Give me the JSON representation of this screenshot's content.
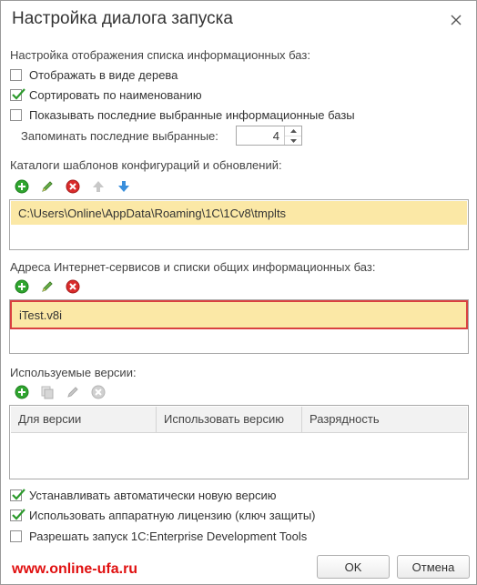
{
  "dialog": {
    "title": "Настройка диалога запуска"
  },
  "display_section": {
    "heading": "Настройка отображения списка информационных баз:",
    "options": [
      {
        "label": "Отображать в виде дерева",
        "checked": false
      },
      {
        "label": "Сортировать по наименованию",
        "checked": true
      },
      {
        "label": "Показывать последние выбранные информационные базы",
        "checked": false
      }
    ],
    "remember_label": "Запоминать последние выбранные:",
    "remember_value": "4"
  },
  "templates_section": {
    "heading": "Каталоги шаблонов конфигураций и обновлений:",
    "toolbar": [
      "add-icon",
      "edit-icon",
      "delete-icon",
      "move-up-icon",
      "move-down-icon"
    ],
    "items": [
      "C:\\Users\\Online\\AppData\\Roaming\\1C\\1Cv8\\tmplts"
    ]
  },
  "services_section": {
    "heading": "Адреса Интернет-сервисов и списки общих информационных баз:",
    "toolbar": [
      "add-icon",
      "edit-icon",
      "delete-icon"
    ],
    "items": [
      "iTest.v8i"
    ]
  },
  "versions_section": {
    "heading": "Используемые версии:",
    "toolbar": [
      "add-icon",
      "copy-icon",
      "edit-icon",
      "delete-icon"
    ],
    "columns": [
      "Для версии",
      "Использовать версию",
      "Разрядность"
    ]
  },
  "bottom_options": [
    {
      "label": "Устанавливать автоматически новую версию",
      "checked": true
    },
    {
      "label": "Использовать аппаратную лицензию (ключ защиты)",
      "checked": true
    },
    {
      "label": "Разрешать запуск 1С:Enterprise Development Tools",
      "checked": false
    }
  ],
  "buttons": {
    "ok": "OK",
    "cancel": "Отмена"
  },
  "watermark": "www.online-ufa.ru",
  "colors": {
    "selection": "#fbe8a6",
    "focus_border": "#d94040",
    "add": "#2fa52f",
    "delete": "#d92b2b",
    "arrow": "#3a8fdc"
  }
}
